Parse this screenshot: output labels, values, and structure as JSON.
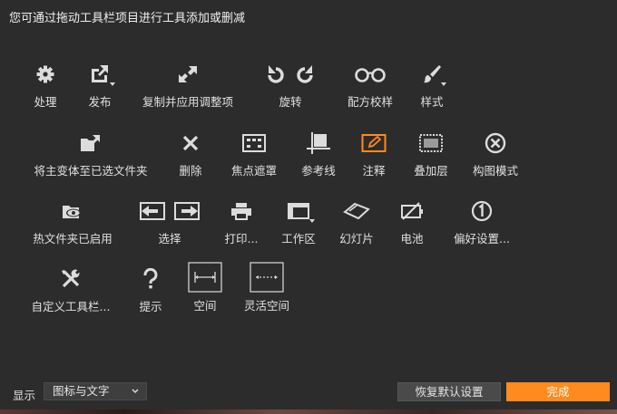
{
  "instruction": "您可通过拖动工具栏项目进行工具添加或删减",
  "tools": {
    "process": "处理",
    "publish": "发布",
    "copy_apply": "复制并应用调整项",
    "rotate": "旋转",
    "formula_proof": "配方校样",
    "style": "样式",
    "move_variant": "将主变体至已选文件夹",
    "delete": "删除",
    "focus_mask": "焦点遮罩",
    "guides": "参考线",
    "annotate": "注释",
    "overlay": "叠加层",
    "composition_mode": "构图模式",
    "hotfolder": "热文件夹已启用",
    "select": "选择",
    "print": "打印...",
    "workspace": "工作区",
    "slideshow": "幻灯片",
    "battery": "电池",
    "preferences": "偏好设置...",
    "customize_toolbar": "自定义工具栏...",
    "tips": "提示",
    "space": "空间",
    "flexible_space": "灵活空间"
  },
  "footer": {
    "display_label": "显示",
    "display_value": "图标与文字",
    "reset_label": "恢复默认设置",
    "done_label": "完成"
  },
  "colors": {
    "background": "#2c2c2c",
    "accent": "#ff8a1e",
    "icon": "#dcdcdc"
  }
}
